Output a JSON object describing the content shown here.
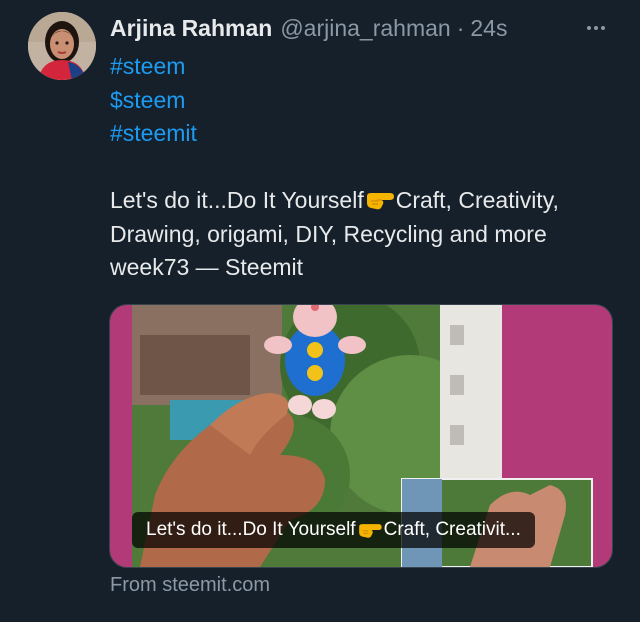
{
  "author": {
    "display_name": "Arjina Rahman",
    "handle": "@arjina_rahman",
    "separator": "·",
    "timestamp": "24s"
  },
  "post": {
    "hashtags": [
      "#steem",
      "$steem",
      "#steemit"
    ],
    "text_part1": "Let's do it...Do It Yourself",
    "text_part2": "Craft, Creativity, Drawing, origami, DIY, Recycling and more week73 — Steemit",
    "inline_emoji": "backhand-index-pointing-right-emoji"
  },
  "link_card": {
    "caption_part1": "Let's do it...Do It Yourself",
    "caption_part2": "Craft, Creativit...",
    "source": "From steemit.com"
  },
  "colors": {
    "background": "#15202b",
    "text": "#e7e9ea",
    "muted": "#8b98a5",
    "link": "#1d9bf0",
    "card_accent": "#b23a78"
  }
}
